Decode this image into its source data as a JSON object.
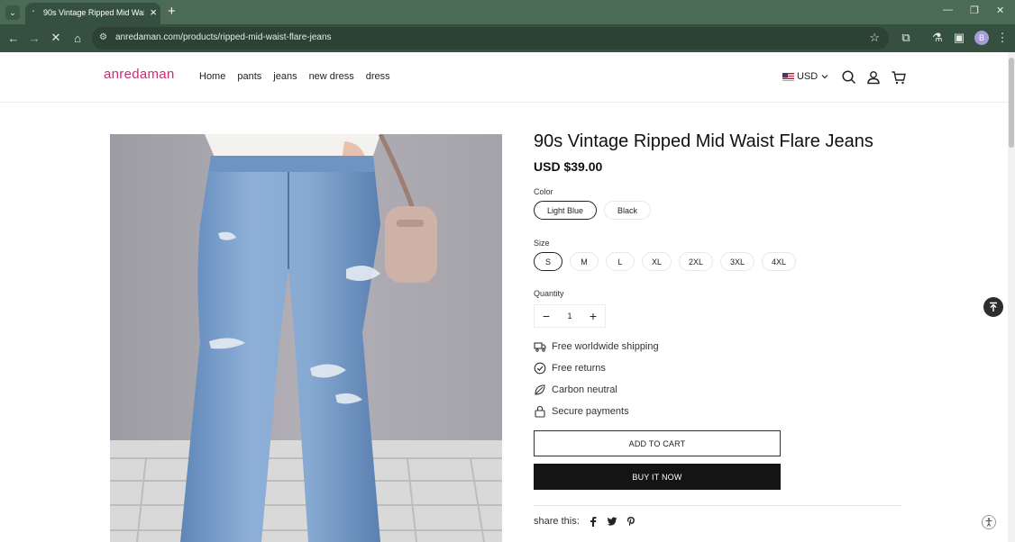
{
  "browser": {
    "tab_title": "90s Vintage Ripped Mid Waist",
    "url": "anredaman.com/products/ripped-mid-waist-flare-jeans",
    "profile_initial": "B"
  },
  "store": {
    "logo": "anredaman",
    "brand_color": "#c73070",
    "menu": [
      "Home",
      "pants",
      "jeans",
      "new dress",
      "dress"
    ],
    "currency": "USD"
  },
  "product": {
    "title": "90s Vintage Ripped Mid Waist Flare Jeans",
    "price": "USD $39.00",
    "color_label": "Color",
    "colors": [
      "Light Blue",
      "Black"
    ],
    "selected_color": "Light Blue",
    "size_label": "Size",
    "sizes": [
      "S",
      "M",
      "L",
      "XL",
      "2XL",
      "3XL",
      "4XL"
    ],
    "selected_size": "S",
    "quantity_label": "Quantity",
    "quantity": "1",
    "features": [
      "Free worldwide shipping",
      "Free returns",
      "Carbon neutral",
      "Secure payments"
    ],
    "add_to_cart": "ADD TO CART",
    "buy_now": "BUY IT NOW",
    "share_label": "share this:"
  }
}
